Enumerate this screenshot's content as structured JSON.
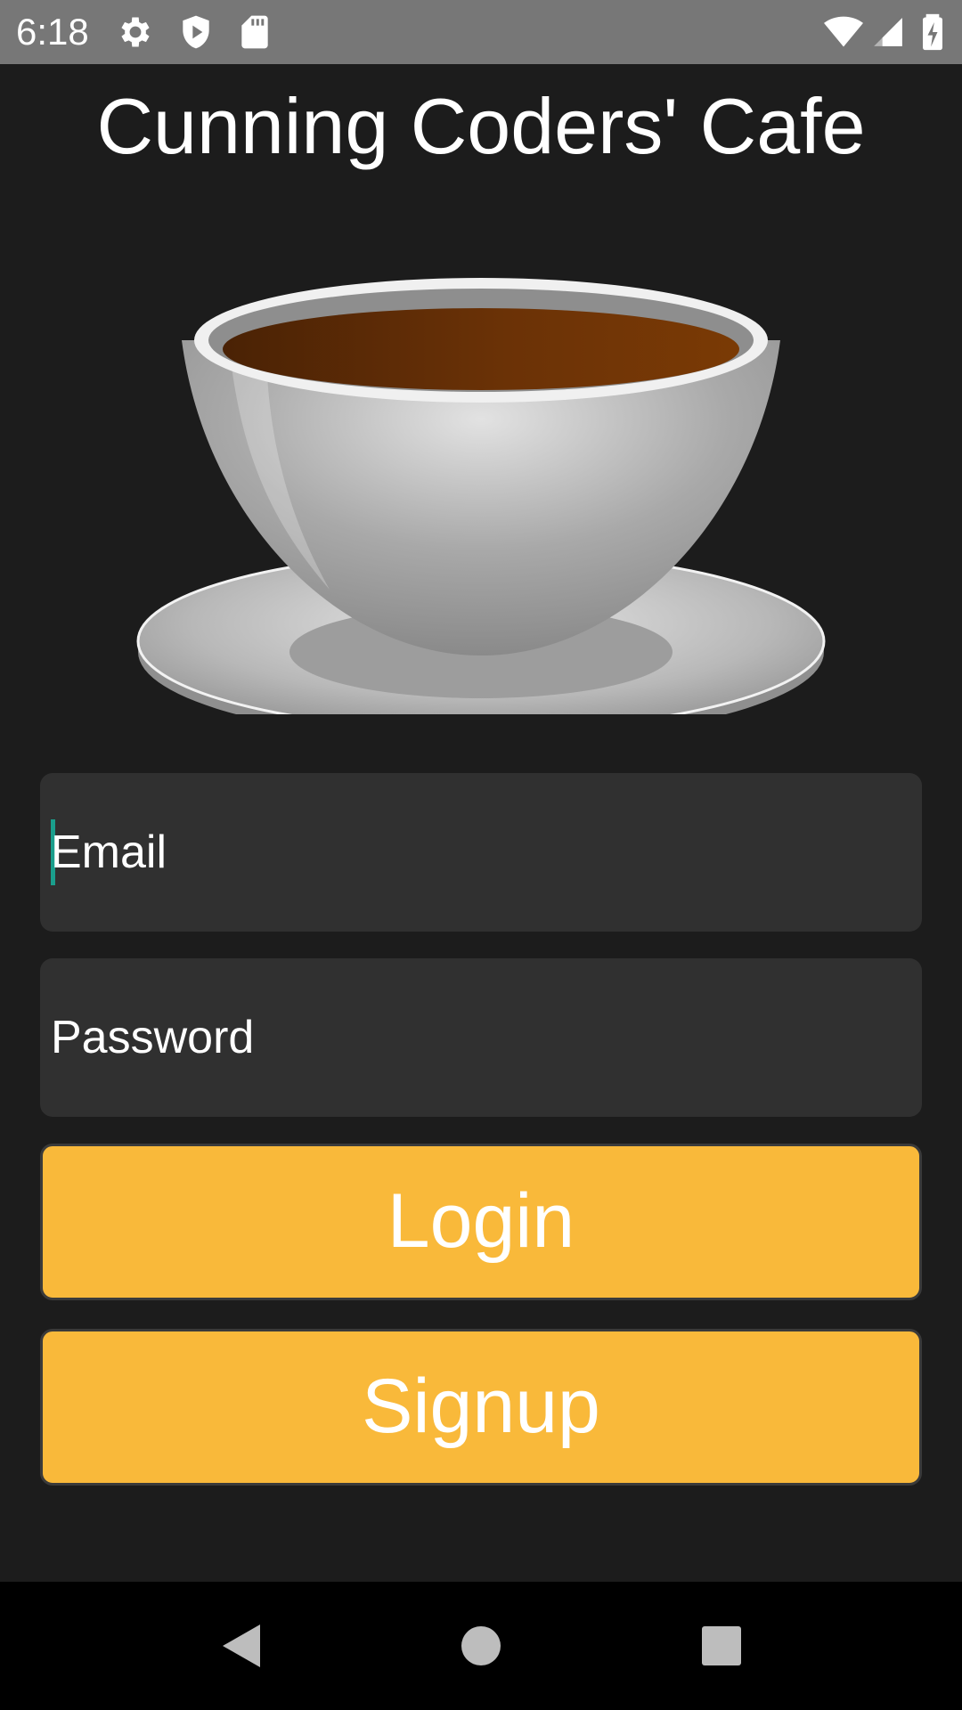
{
  "status_bar": {
    "time": "6:18",
    "icons": [
      "gear-icon",
      "shield-play-icon",
      "sd-card-icon",
      "wifi-icon",
      "signal-icon",
      "battery-charging-icon"
    ],
    "color": "#777777"
  },
  "app": {
    "title": "Cunning Coders' Cafe",
    "image": "coffee-cup-icon",
    "email_placeholder": "Email",
    "password_placeholder": "Password",
    "login_label": "Login",
    "signup_label": "Signup",
    "accent_color": "#f9b93a",
    "cursor_color": "#1a9e8c",
    "background_color": "#1c1c1c"
  },
  "nav_bar": {
    "icons": [
      "back-triangle-icon",
      "home-circle-icon",
      "recents-square-icon"
    ]
  }
}
